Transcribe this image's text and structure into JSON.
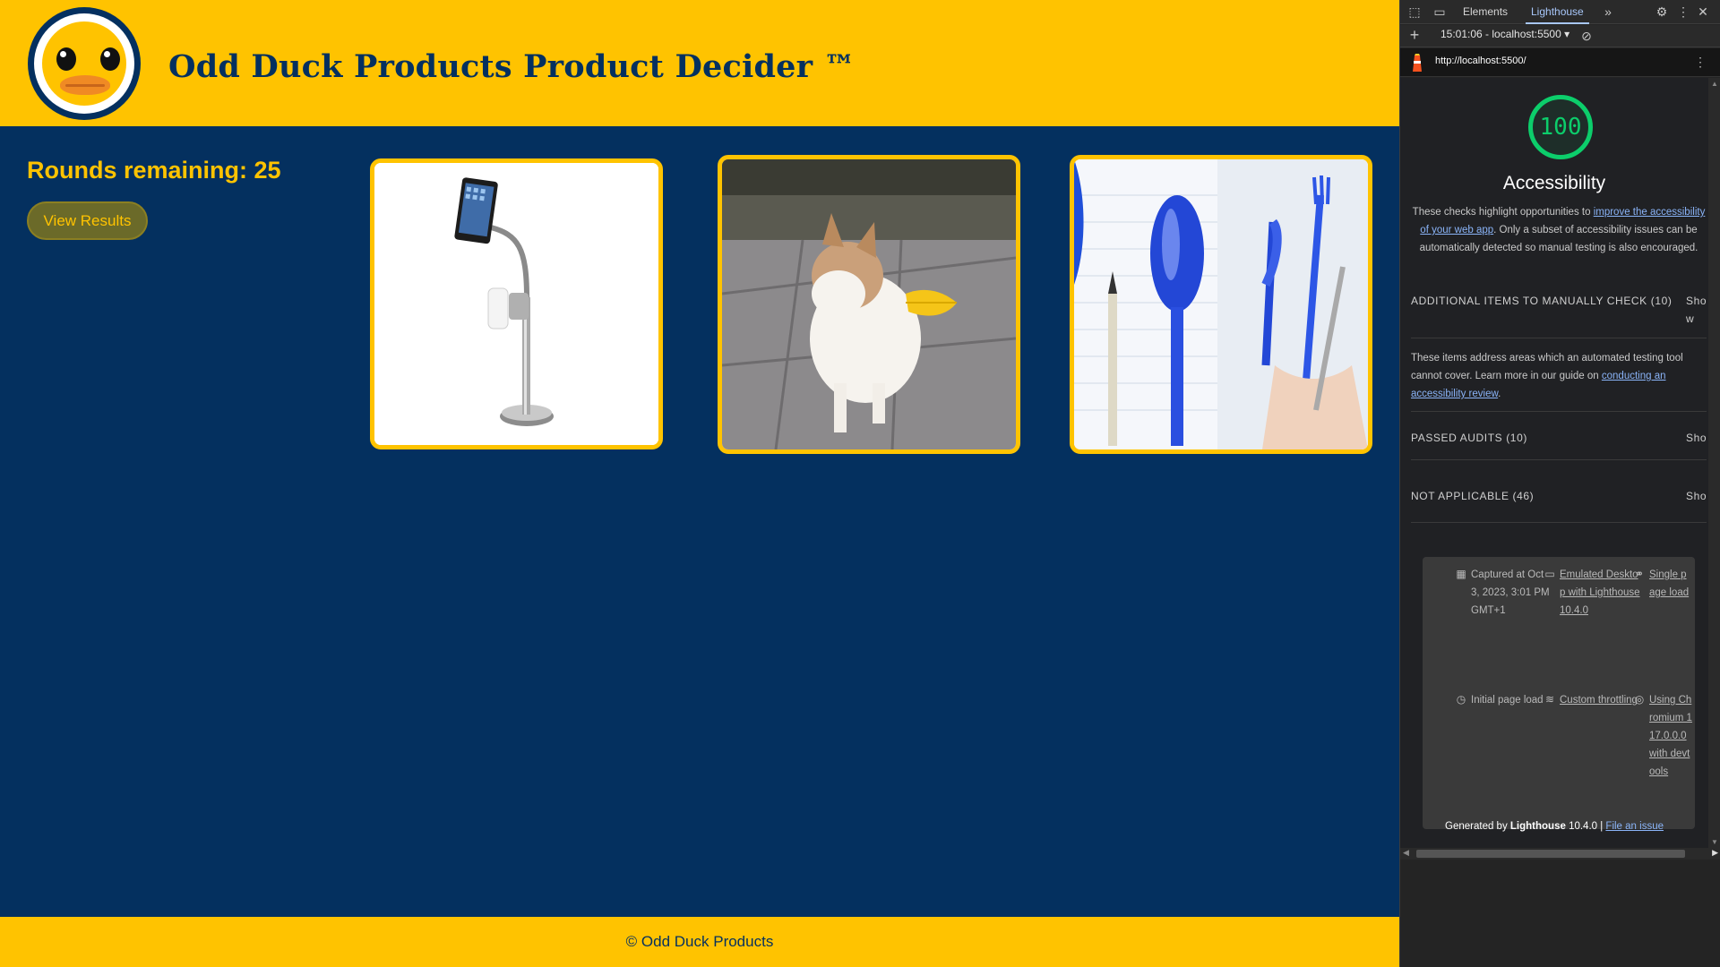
{
  "app": {
    "title": "Odd Duck Products Product Decider ™",
    "rounds_remaining": "Rounds remaining: 25",
    "view_results_label": "View Results",
    "footer": "© Odd Duck Products",
    "colors": {
      "primary": "#ffc300",
      "background": "#04305f"
    },
    "products": [
      {
        "name": "pet-sweep-ipad-stand",
        "image_icon": "ipad-toilet-paper-stand-image"
      },
      {
        "name": "dog-duck-bill",
        "image_icon": "dog-duck-muzzle-image"
      },
      {
        "name": "pen-utensils",
        "image_icon": "pen-cutlery-image"
      }
    ]
  },
  "devtools": {
    "tabs": [
      "Elements",
      "Lighthouse"
    ],
    "active_tab": "Lighthouse",
    "report_select": "15:01:06 - localhost:5500",
    "url": "http://localhost:5500/",
    "report": {
      "score": "100",
      "score_color": "#0cce6b",
      "category": "Accessibility",
      "description_pre": "These checks highlight opportunities to ",
      "description_link": "improve the accessibility of your web app",
      "description_post": ". Only a subset of accessibility issues can be automatically detected so manual testing is also encouraged.",
      "manual_title": "ADDITIONAL ITEMS TO MANUALLY CHECK (10)",
      "show_label": "Show",
      "manual_desc_pre": "These items address areas which an automated testing tool cannot cover. Learn more in our guide on ",
      "manual_desc_link": "conducting an accessibility review",
      "manual_desc_post": ".",
      "passed_title": "PASSED AUDITS (10)",
      "na_title": "NOT APPLICABLE (46)",
      "meta": {
        "captured": "Captured at Oct 3, 2023, 3:01 PM GMT+1",
        "emulated": "Emulated Desktop with Lighthouse 10.4.0",
        "single_page": "Single page load",
        "initial_load": "Initial page load",
        "throttling": "Custom throttling",
        "chromium": "Using Chromium 117.0.0.0 with devtools"
      },
      "generated_pre": "Generated by ",
      "generated_brand": "Lighthouse",
      "generated_version": " 10.4.0 | ",
      "file_issue": "File an issue"
    }
  }
}
